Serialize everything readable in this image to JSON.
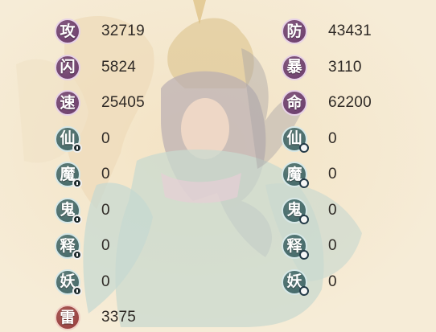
{
  "colors": {
    "purple_badge": "#6a3a6c",
    "teal_badge": "#3f6566",
    "red_badge": "#963a3a",
    "background": "#f6ecd7",
    "value_text": "#2f2a26"
  },
  "stats": [
    {
      "label": "攻",
      "value": "32719",
      "badge": "purple",
      "marker": "none"
    },
    {
      "label": "防",
      "value": "43431",
      "badge": "purple",
      "marker": "none"
    },
    {
      "label": "闪",
      "value": "5824",
      "badge": "purple",
      "marker": "none"
    },
    {
      "label": "暴",
      "value": "3110",
      "badge": "purple",
      "marker": "none"
    },
    {
      "label": "速",
      "value": "25405",
      "badge": "purple",
      "marker": "none"
    },
    {
      "label": "命",
      "value": "62200",
      "badge": "purple",
      "marker": "none"
    },
    {
      "label": "仙",
      "value": "0",
      "badge": "teal",
      "marker": "info"
    },
    {
      "label": "仙",
      "value": "0",
      "badge": "teal",
      "marker": "ring"
    },
    {
      "label": "魔",
      "value": "0",
      "badge": "teal",
      "marker": "info"
    },
    {
      "label": "魔",
      "value": "0",
      "badge": "teal",
      "marker": "ring"
    },
    {
      "label": "鬼",
      "value": "0",
      "badge": "teal",
      "marker": "info"
    },
    {
      "label": "鬼",
      "value": "0",
      "badge": "teal",
      "marker": "ring"
    },
    {
      "label": "释",
      "value": "0",
      "badge": "teal",
      "marker": "info"
    },
    {
      "label": "释",
      "value": "0",
      "badge": "teal",
      "marker": "ring"
    },
    {
      "label": "妖",
      "value": "0",
      "badge": "teal",
      "marker": "info"
    },
    {
      "label": "妖",
      "value": "0",
      "badge": "teal",
      "marker": "ring"
    },
    {
      "label": "雷",
      "value": "3375",
      "badge": "red",
      "marker": "none"
    }
  ]
}
